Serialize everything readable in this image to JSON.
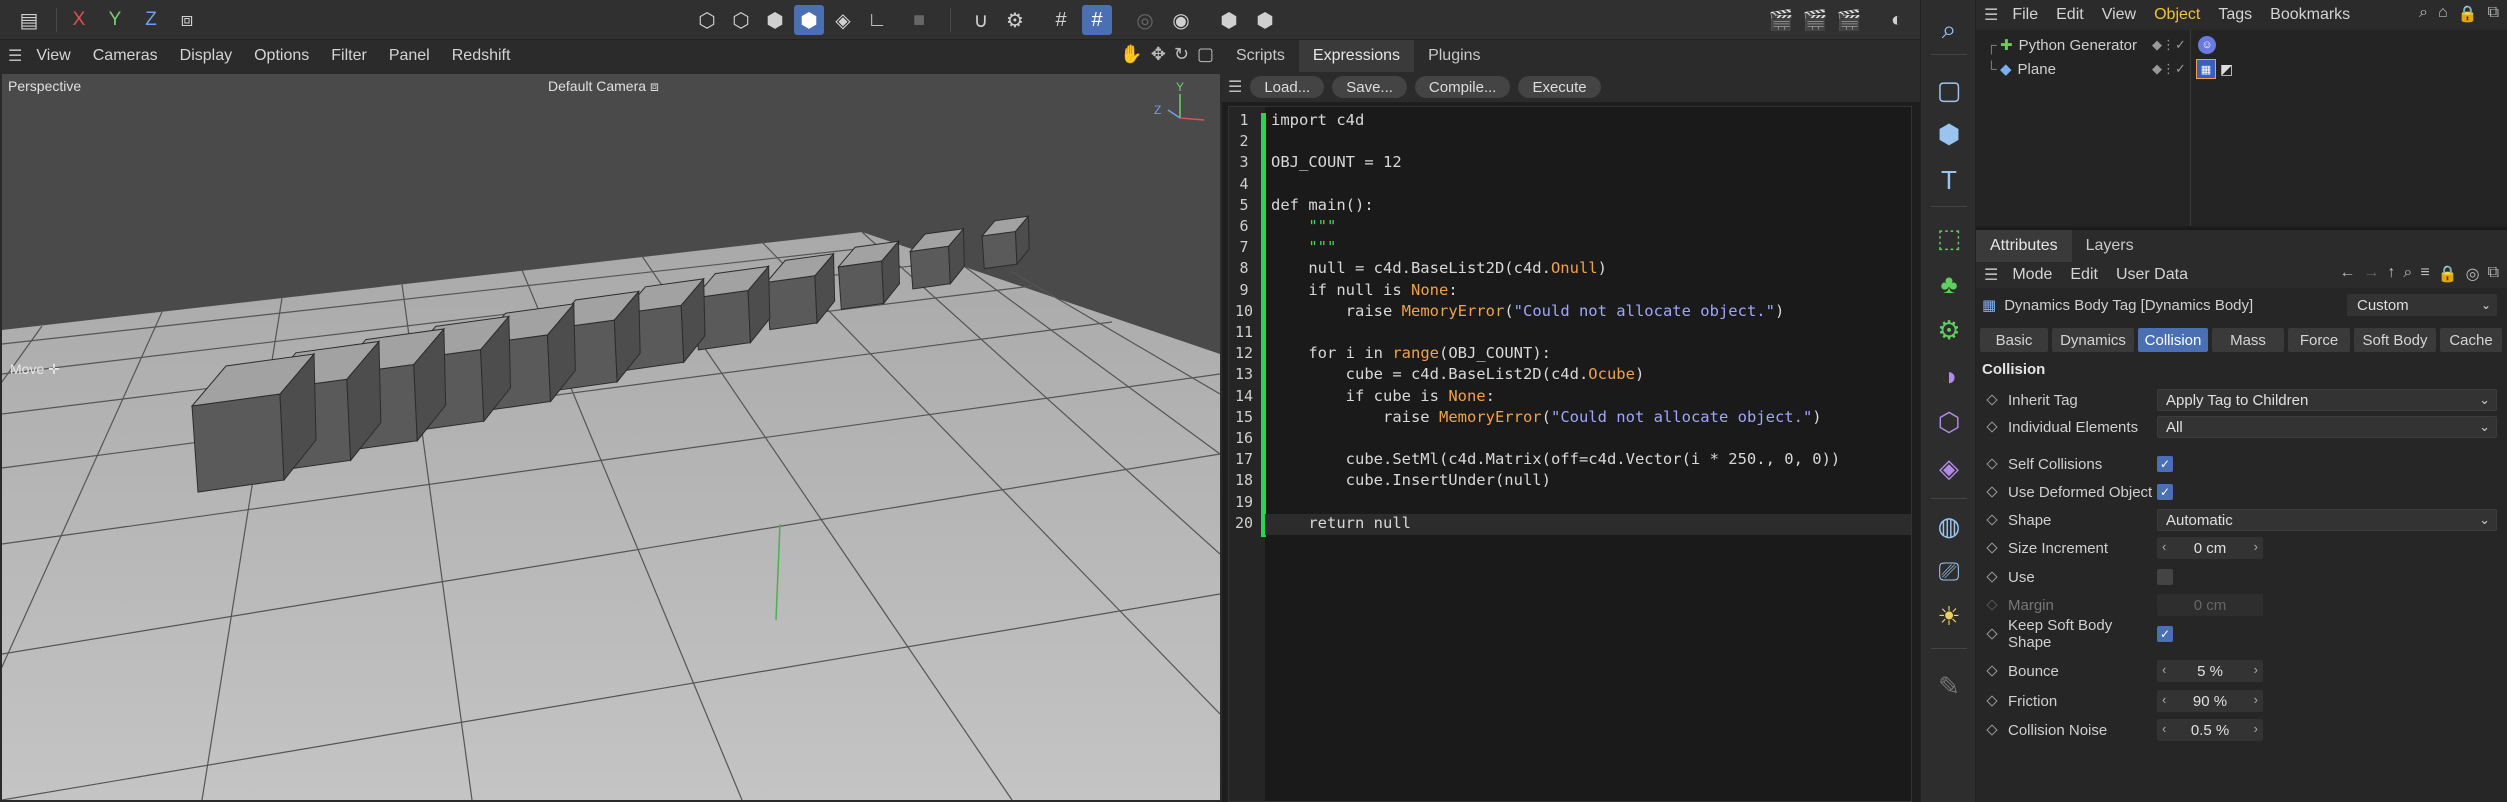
{
  "toolbar": {
    "axis_x": "X",
    "axis_y": "Y",
    "axis_z": "Z"
  },
  "viewport": {
    "menu": [
      "View",
      "Cameras",
      "Display",
      "Options",
      "Filter",
      "Panel",
      "Redshift"
    ],
    "projection_label": "Perspective",
    "camera_label": "Default Camera",
    "tool_label": "Move",
    "axis_gizmo": {
      "y": "Y",
      "z": "Z"
    },
    "cube_count": 12
  },
  "script_manager": {
    "tabs": [
      "Scripts",
      "Expressions",
      "Plugins"
    ],
    "active_tab": "Expressions",
    "buttons": [
      "Load...",
      "Save...",
      "Compile...",
      "Execute"
    ],
    "code_lines": [
      "import c4d",
      "",
      "OBJ_COUNT = 12",
      "",
      "def main():",
      "    \"\"\"",
      "    \"\"\"",
      "    null = c4d.BaseList2D(c4d.Onull)",
      "    if null is None:",
      "        raise MemoryError(\"Could not allocate object.\")",
      "",
      "    for i in range(OBJ_COUNT):",
      "        cube = c4d.BaseList2D(c4d.Ocube)",
      "        if cube is None:",
      "            raise MemoryError(\"Could not allocate object.\")",
      "",
      "        cube.SetMl(c4d.Matrix(off=c4d.Vector(i * 250., 0, 0))",
      "        cube.InsertUnder(null)",
      "",
      "    return null"
    ]
  },
  "object_manager": {
    "menu": [
      "File",
      "Edit",
      "View",
      "Object",
      "Tags",
      "Bookmarks"
    ],
    "active_menu": "Object",
    "objects": [
      {
        "name": "Python Generator"
      },
      {
        "name": "Plane"
      }
    ]
  },
  "attributes": {
    "tabs": [
      "Attributes",
      "Layers"
    ],
    "menu": [
      "Mode",
      "Edit",
      "User Data"
    ],
    "object_title": "Dynamics Body Tag [Dynamics Body]",
    "preset": "Custom",
    "subtabs": [
      "Basic",
      "Dynamics",
      "Collision",
      "Mass",
      "Force",
      "Soft Body",
      "Cache"
    ],
    "active_subtab": "Collision",
    "section_title": "Collision",
    "fields": {
      "inherit_tag": {
        "label": "Inherit Tag",
        "value": "Apply Tag to Children"
      },
      "individual_elements": {
        "label": "Individual Elements",
        "value": "All"
      },
      "self_collisions": {
        "label": "Self Collisions",
        "checked": true
      },
      "use_deformed_object": {
        "label": "Use Deformed Object",
        "checked": true
      },
      "shape": {
        "label": "Shape",
        "value": "Automatic"
      },
      "size_increment": {
        "label": "Size Increment",
        "value": "0 cm"
      },
      "use": {
        "label": "Use",
        "checked": false
      },
      "margin": {
        "label": "Margin",
        "value": "0 cm"
      },
      "keep_soft_body_shape": {
        "label": "Keep Soft Body Shape",
        "checked": true
      },
      "bounce": {
        "label": "Bounce",
        "value": "5 %"
      },
      "friction": {
        "label": "Friction",
        "value": "90 %"
      },
      "collision_noise": {
        "label": "Collision Noise",
        "value": "0.5 %"
      }
    }
  },
  "colors": {
    "accent": "#4a6fb3",
    "active_menu": "#f0c040",
    "code_bar": "#2bd44a"
  }
}
